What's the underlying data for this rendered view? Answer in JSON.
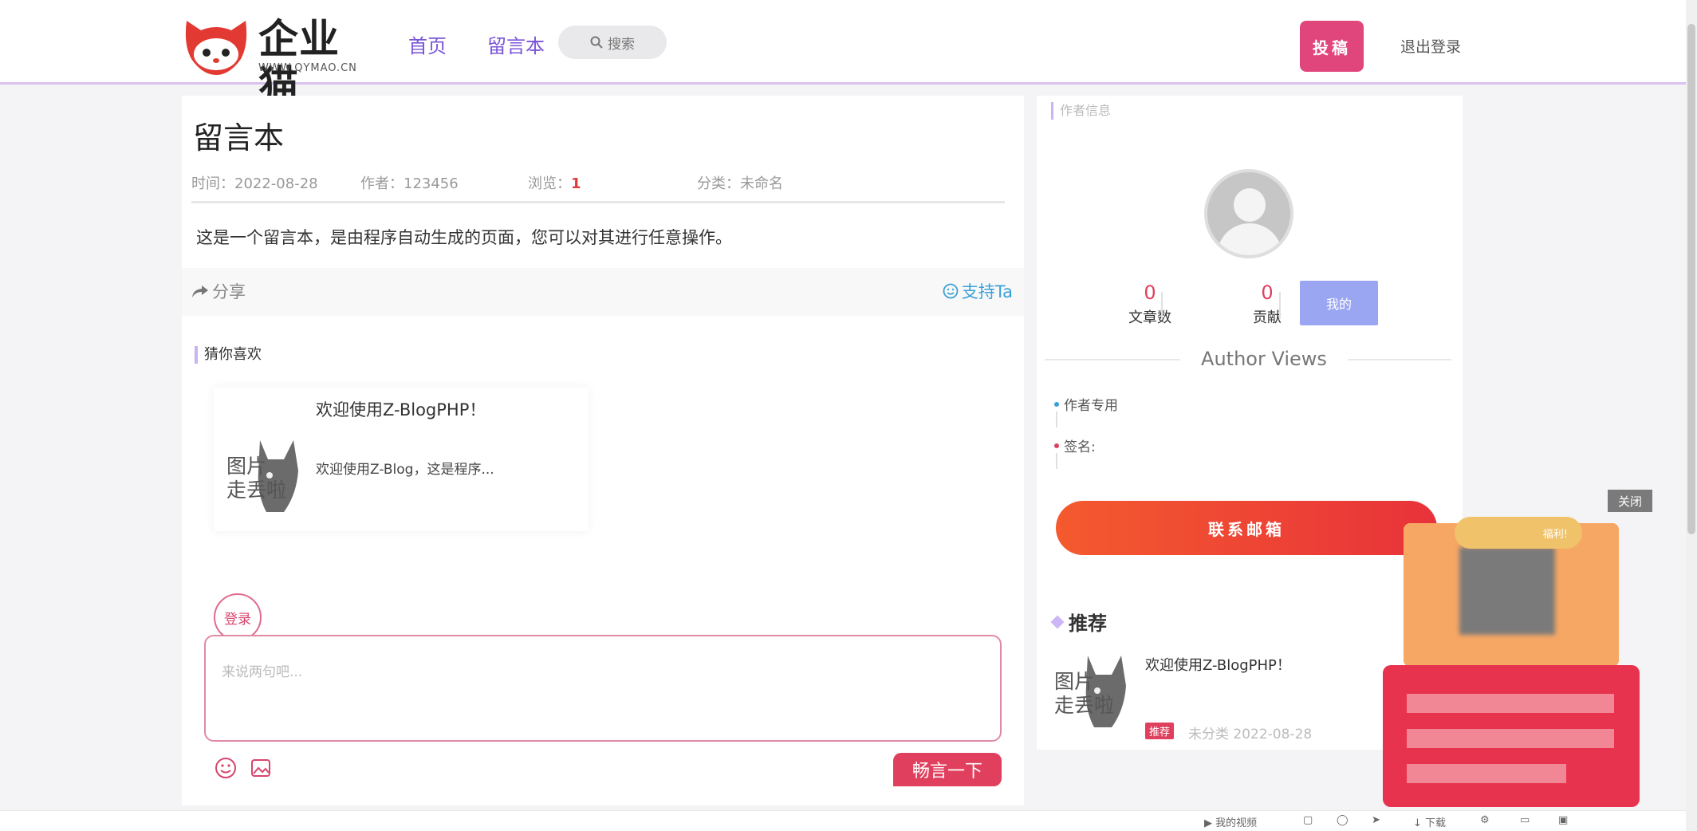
{
  "header": {
    "logo_text": "企业猫",
    "logo_sub": "WWW.QYMAO.CN",
    "nav": [
      {
        "label": "首页"
      },
      {
        "label": "留言本"
      }
    ],
    "search_label": "搜索",
    "post_button": "投稿",
    "logout": "退出登录"
  },
  "article": {
    "title": "留言本",
    "meta": {
      "time": "时间：2022-08-28",
      "author": "作者：123456",
      "views_label": "浏览：",
      "views_value": "1",
      "category": "分类：未命名"
    },
    "body": "这是一个留言本，是由程序自动生成的页面，您可以对其进行任意操作。",
    "share": "分享",
    "support": "支持Ta"
  },
  "guess": {
    "title": "猜你喜欢",
    "card": {
      "image_text": [
        "图片",
        "走丢啦"
      ],
      "title": "欢迎使用Z-BlogPHP！",
      "desc": "欢迎使用Z-Blog，这是程序..."
    }
  },
  "comment": {
    "login_label": "登录",
    "placeholder": "来说两句吧...",
    "submit_label": "畅言一下"
  },
  "sidebar": {
    "section_title": "作者信息",
    "stats": [
      {
        "value": "0",
        "label": "文章数"
      },
      {
        "value": "0",
        "label": "贡献"
      }
    ],
    "follow_label": "我的",
    "author_views_title": "Author Views",
    "timeline": [
      {
        "text": "作者专用",
        "color": "#3aa0d8"
      },
      {
        "text": "签名:",
        "color": "#e0405e"
      }
    ],
    "contact_button": "联系邮箱",
    "recommend_title": "推荐",
    "recommend": {
      "image_text": [
        "图片",
        "走丢啦"
      ],
      "title": "欢迎使用Z-BlogPHP！",
      "badge": "推荐",
      "meta": "未分类  2022-08-28"
    }
  },
  "ad": {
    "close_label": "关闭",
    "ribbon_text": "福利!"
  },
  "bottom_bar": {
    "items": [
      "我的视频",
      "下载"
    ]
  },
  "colors": {
    "accent_purple": "#7a54d8",
    "post_button": "#e0457b",
    "highlight_red": "#e0405e",
    "follow_button": "#9aa6f2",
    "header_border": "#d8c2ee"
  }
}
